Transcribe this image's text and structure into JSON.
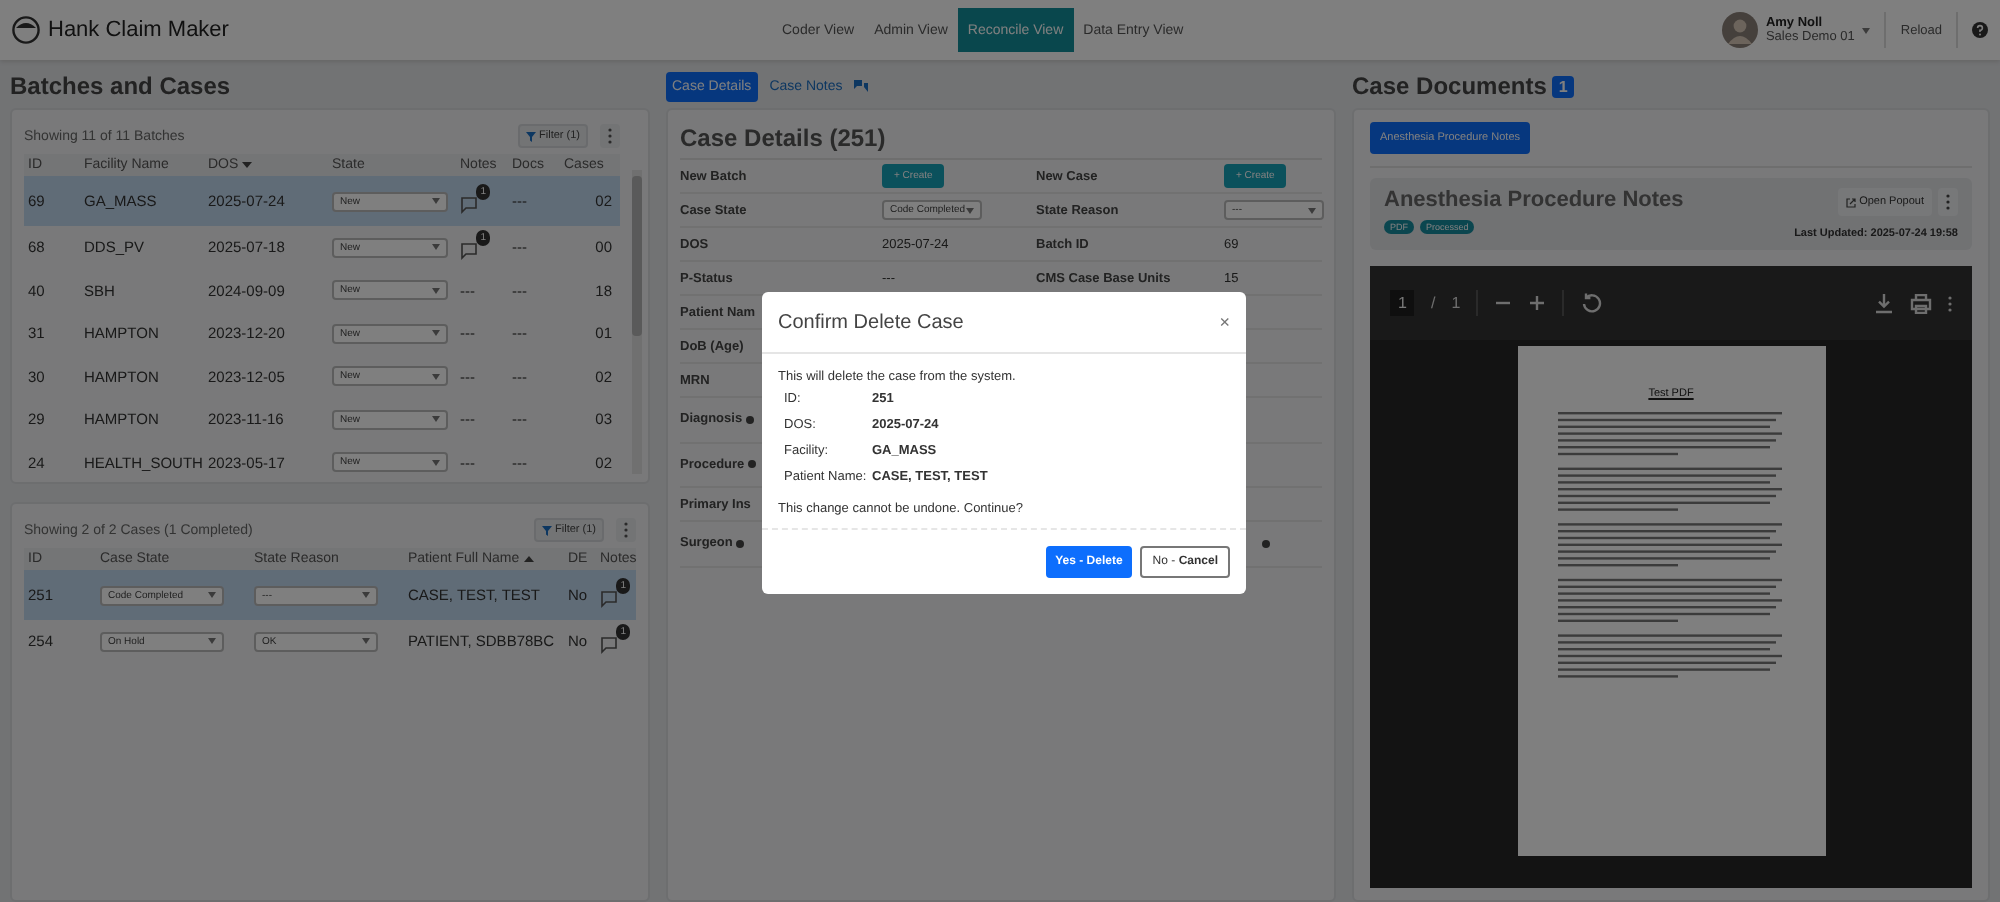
{
  "app": {
    "title": "Hank Claim Maker"
  },
  "nav": [
    {
      "label": "Coder View",
      "selected": false
    },
    {
      "label": "Admin View",
      "selected": false
    },
    {
      "label": "Reconcile View",
      "selected": true
    },
    {
      "label": "Data Entry View",
      "selected": false
    }
  ],
  "user": {
    "name": "Amy Noll",
    "org": "Sales Demo 01",
    "reload": "Reload"
  },
  "batches": {
    "title": "Batches and Cases",
    "summary": "Showing 11 of 11 Batches",
    "filter": "Filter (1)",
    "columns": [
      {
        "label": "ID"
      },
      {
        "label": "Facility Name"
      },
      {
        "label": "DOS",
        "sorted_desc": true
      },
      {
        "label": "State"
      },
      {
        "label": "Notes"
      },
      {
        "label": "Docs"
      },
      {
        "label": "Cases"
      }
    ],
    "rows": [
      {
        "id": "69",
        "facility": "GA_MASS",
        "dos": "2025-07-24",
        "state": "New",
        "notes": {
          "kind": "icon",
          "badge": "1"
        },
        "docs": "---",
        "cases": "02",
        "selected": true
      },
      {
        "id": "68",
        "facility": "DDS_PV",
        "dos": "2025-07-18",
        "state": "New",
        "notes": {
          "kind": "icon",
          "badge": "1"
        },
        "docs": "---",
        "cases": "00",
        "selected": false
      },
      {
        "id": "40",
        "facility": "SBH",
        "dos": "2024-09-09",
        "state": "New",
        "notes": {
          "kind": "text",
          "text": "---"
        },
        "docs": "---",
        "cases": "18",
        "selected": false
      },
      {
        "id": "31",
        "facility": "HAMPTON",
        "dos": "2023-12-20",
        "state": "New",
        "notes": {
          "kind": "text",
          "text": "---"
        },
        "docs": "---",
        "cases": "01",
        "selected": false
      },
      {
        "id": "30",
        "facility": "HAMPTON",
        "dos": "2023-12-05",
        "state": "New",
        "notes": {
          "kind": "text",
          "text": "---"
        },
        "docs": "---",
        "cases": "02",
        "selected": false
      },
      {
        "id": "29",
        "facility": "HAMPTON",
        "dos": "2023-11-16",
        "state": "New",
        "notes": {
          "kind": "text",
          "text": "---"
        },
        "docs": "---",
        "cases": "03",
        "selected": false
      },
      {
        "id": "24",
        "facility": "HEALTH_SOUTH",
        "dos": "2023-05-17",
        "state": "New",
        "notes": {
          "kind": "text",
          "text": "---"
        },
        "docs": "---",
        "cases": "02",
        "selected": false
      }
    ]
  },
  "cases": {
    "summary": "Showing 2 of 2 Cases (1 Completed)",
    "filter": "Filter (1)",
    "columns": [
      {
        "label": "ID"
      },
      {
        "label": "Case State"
      },
      {
        "label": "State Reason"
      },
      {
        "label": "Patient Full Name",
        "sorted_asc": true
      },
      {
        "label": "DE"
      },
      {
        "label": "Notes"
      }
    ],
    "rows": [
      {
        "id": "251",
        "state": "Code Completed",
        "reason": "---",
        "patient": "CASE, TEST, TEST",
        "de": "No",
        "notes_badge": "1",
        "selected": true
      },
      {
        "id": "254",
        "state": "On Hold",
        "reason": "OK",
        "patient": "PATIENT, SDBB78BC",
        "de": "No",
        "notes_badge": "1",
        "selected": false
      }
    ]
  },
  "details": {
    "tabs": [
      {
        "label": "Case Details",
        "selected": true
      },
      {
        "label": "Case Notes",
        "selected": false
      }
    ],
    "title": "Case Details (251)",
    "rows": [
      {
        "label": "New Batch",
        "value": {
          "kind": "button",
          "text": "+ Create"
        },
        "label2": "New Case",
        "value2": {
          "kind": "button",
          "text": "+ Create"
        }
      },
      {
        "label": "Case State",
        "value": {
          "kind": "select",
          "text": "Code Completed"
        },
        "label2": "State Reason",
        "value2": {
          "kind": "select",
          "text": "---"
        }
      },
      {
        "label": "DOS",
        "value": {
          "kind": "text",
          "text": "2025-07-24"
        },
        "label2": "Batch ID",
        "value2": {
          "kind": "text",
          "text": "69"
        }
      },
      {
        "label": "P-Status",
        "value": {
          "kind": "text",
          "text": "---"
        },
        "label2": "CMS Case Base Units",
        "value2": {
          "kind": "text",
          "text": "15"
        }
      },
      {
        "label": "Patient Nam"
      },
      {
        "label": "DoB (Age)"
      },
      {
        "label": "MRN"
      },
      {
        "label": "Diagnosis",
        "required": true
      },
      {
        "label": "Procedure",
        "required": true
      },
      {
        "label": "Primary Ins"
      },
      {
        "label": "Surgeon",
        "required": true,
        "marker2": true
      }
    ]
  },
  "documents": {
    "title": "Case Documents",
    "count": "1",
    "tabs": [
      {
        "label": "Anesthesia Procedure Notes",
        "selected": true
      }
    ],
    "doc_title": "Anesthesia Procedure Notes",
    "tags": [
      "PDF",
      "Processed"
    ],
    "popout": "Open Popout",
    "updated": "Last Updated: 2025-07-24 19:58",
    "viewer": {
      "page": "1",
      "separator": "/",
      "pages": "1",
      "pdf_title": "Test PDF"
    }
  },
  "modal": {
    "title": "Confirm Delete Case",
    "close": "×",
    "intro": "This will delete the case from the system.",
    "fields": [
      {
        "label": "ID:",
        "value": "251"
      },
      {
        "label": "DOS:",
        "value": "2025-07-24"
      },
      {
        "label": "Facility:",
        "value": "GA_MASS"
      },
      {
        "label": "Patient Name:",
        "value": "CASE, TEST, TEST"
      }
    ],
    "outro": "This change cannot be undone. Continue?",
    "confirm": "Yes - Delete",
    "cancel": "No - **Cancel**"
  }
}
